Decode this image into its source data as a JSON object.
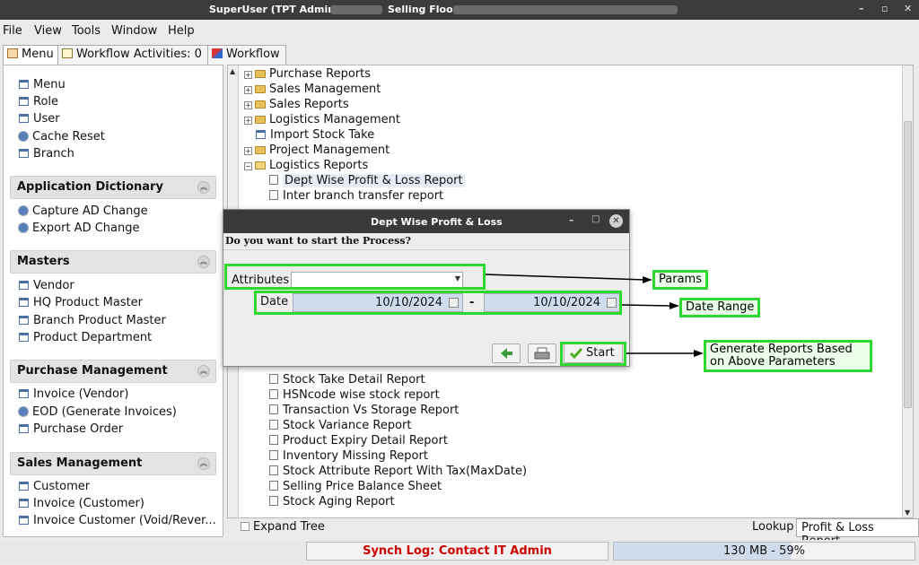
{
  "window": {
    "title_left": "SuperUser (TPT Admin) @",
    "title_right": "Selling Floor",
    "minimize": "–",
    "maximize": "▫",
    "close": "✕"
  },
  "menubar": {
    "file": "File",
    "view": "View",
    "tools": "Tools",
    "window": "Window",
    "help": "Help"
  },
  "tabs": {
    "menu": "Menu",
    "workflow_activities": "Workflow Activities: 0",
    "workflow": "Workflow"
  },
  "sidebar": {
    "top_items": [
      "Menu",
      "Role",
      "User",
      "Cache Reset",
      "Branch"
    ],
    "sections": [
      {
        "title": "Application Dictionary",
        "items": [
          "Capture AD Change",
          "Export AD Change"
        ]
      },
      {
        "title": "Masters",
        "items": [
          "Vendor",
          "HQ Product Master",
          "Branch Product Master",
          "Product Department"
        ]
      },
      {
        "title": "Purchase Management",
        "items": [
          "Invoice (Vendor)",
          "EOD (Generate Invoices)",
          "Purchase Order"
        ]
      },
      {
        "title": "Sales Management",
        "items": [
          "Customer",
          "Invoice (Customer)",
          "Invoice Customer (Void/Rever..."
        ]
      }
    ]
  },
  "tree": {
    "folders": [
      "Purchase Reports",
      "Sales Management",
      "Sales Reports",
      "Logistics Management"
    ],
    "import_stock": "Import Stock Take",
    "project_management": "Project Management",
    "logistics_reports": "Logistics Reports",
    "reports_top": [
      "Dept Wise Profit & Loss Report",
      "Inter branch transfer report"
    ],
    "reports_bottom": [
      "Stock Take Detail Report",
      "HSNcode wise stock report",
      "Transaction Vs Storage Report",
      "Stock Variance Report",
      "Product Expiry Detail Report",
      "Inventory Missing Report",
      "Stock Attribute Report With Tax(MaxDate)",
      "Selling Price Balance Sheet",
      "Stock Aging Report"
    ]
  },
  "bottom": {
    "expand_tree": "Expand Tree",
    "lookup": "Lookup",
    "active_tab": "Profit & Loss Report"
  },
  "status": {
    "synch": "Synch Log: Contact IT Admin",
    "memory": "130 MB - 59%"
  },
  "dialog": {
    "title": "Dept Wise Profit & Loss",
    "question": "Do you want to start the Process?",
    "attributes_label": "Attributes",
    "attributes_value": "",
    "date_label": "Date",
    "date_from": "10/10/2024",
    "date_to": "10/10/2024",
    "dash": "-",
    "start_label": "Start"
  },
  "annotations": {
    "params": "Params",
    "date_range": "Date Range",
    "generate": "Generate Reports Based on Above Parameters",
    "color": "#2ed82e"
  }
}
